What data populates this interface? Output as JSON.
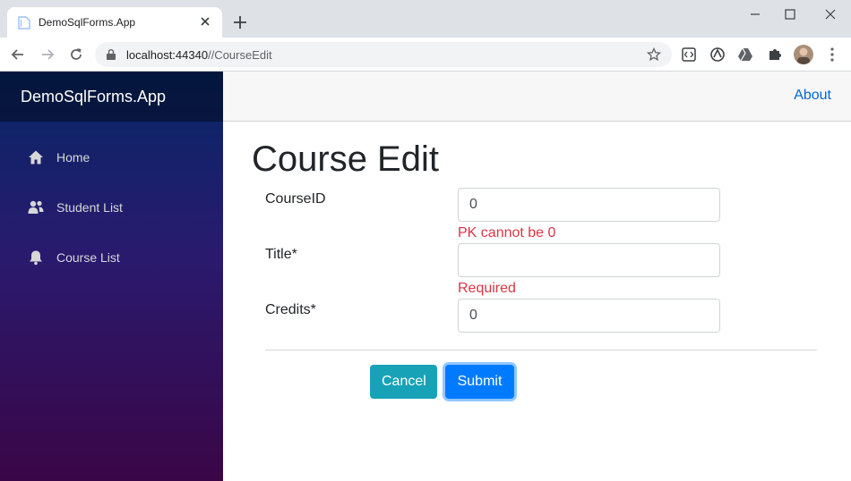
{
  "browser": {
    "tab_title": "DemoSqlForms.App",
    "url_host": "localhost:44340",
    "url_path": "//CourseEdit"
  },
  "app": {
    "brand": "DemoSqlForms.App",
    "about": "About"
  },
  "sidebar": {
    "items": [
      {
        "label": "Home",
        "icon": "home-icon"
      },
      {
        "label": "Student List",
        "icon": "people-icon"
      },
      {
        "label": "Course List",
        "icon": "bell-icon"
      }
    ]
  },
  "form": {
    "title": "Course Edit",
    "fields": [
      {
        "label": "CourseID",
        "value": "0",
        "validation": "PK cannot be 0"
      },
      {
        "label": "Title*",
        "value": "",
        "validation": "Required"
      },
      {
        "label": "Credits*",
        "value": "0",
        "validation": ""
      }
    ],
    "cancel_label": "Cancel",
    "submit_label": "Submit"
  },
  "colors": {
    "validation": "#dc3545",
    "primary": "#007bff",
    "info": "#17a2b8",
    "link": "#0366d6"
  }
}
